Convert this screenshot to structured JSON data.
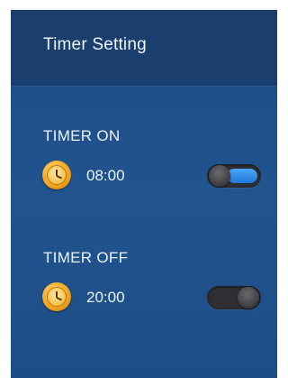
{
  "header": {
    "title": "Timer Setting"
  },
  "timers": [
    {
      "label": "TIMER ON",
      "time": "08:00",
      "icon": "clock-icon",
      "enabled": true
    },
    {
      "label": "TIMER OFF",
      "time": "20:00",
      "icon": "clock-icon",
      "enabled": false
    }
  ],
  "colors": {
    "panel_bg": "#1f4f86",
    "header_bg": "#1a3f6e",
    "toggle_on_accent": "#1f78d6",
    "clock_gold": "#f2a823"
  }
}
